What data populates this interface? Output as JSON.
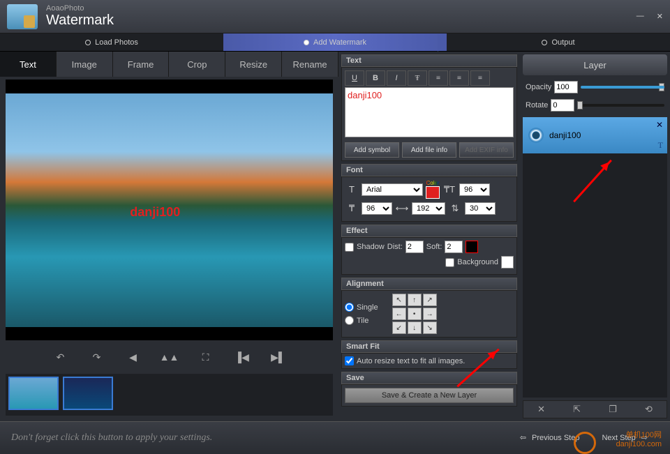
{
  "title": {
    "brand": "AoaoPhoto",
    "app": "Watermark"
  },
  "steps": {
    "load": "Load Photos",
    "add": "Add Watermark",
    "output": "Output"
  },
  "tabs": [
    "Text",
    "Image",
    "Frame",
    "Crop",
    "Resize",
    "Rename"
  ],
  "watermark_text": "danji100",
  "panels": {
    "text": {
      "title": "Text",
      "value": "danji100",
      "add_symbol": "Add symbol",
      "add_file": "Add file info",
      "add_exif": "Add EXIF info"
    },
    "font": {
      "title": "Font",
      "family": "Arial",
      "color_label": "Color",
      "size1": "96",
      "size2": "96",
      "size3": "192",
      "size4": "30"
    },
    "effect": {
      "title": "Effect",
      "shadow": "Shadow",
      "dist": "Dist:",
      "dist_v": "2",
      "soft": "Soft:",
      "soft_v": "2",
      "bg": "Background"
    },
    "align": {
      "title": "Alignment",
      "single": "Single",
      "tile": "Tile"
    },
    "smartfit": {
      "title": "Smart Fit",
      "auto": "Auto resize text to fit all images."
    },
    "save": {
      "title": "Save",
      "btn": "Save & Create a New Layer"
    }
  },
  "layer": {
    "title": "Layer",
    "opacity": "Opacity",
    "opacity_v": "100",
    "rotate": "Rotate",
    "rotate_v": "0",
    "item": "danji100"
  },
  "footer": {
    "hint": "Don't forget click this button to apply your settings.",
    "prev": "Previous Step",
    "next": "Next Step"
  },
  "site": {
    "brand": "单机100网",
    "url": "danji100.com"
  }
}
